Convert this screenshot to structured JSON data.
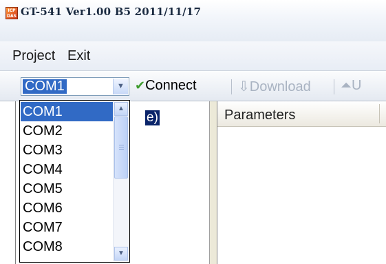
{
  "window": {
    "title": "GT-541 Ver1.00 B5 2011/11/17",
    "icon_text": "ICP DAS"
  },
  "menu": {
    "items": [
      "Project",
      "Exit"
    ]
  },
  "toolbar": {
    "port_value": "COM1",
    "connect_label": "Connect",
    "download_label": "Download",
    "upload_label": "U"
  },
  "tree": {
    "selected_fragment": "e)"
  },
  "grid": {
    "header": "Parameters"
  },
  "dropdown": {
    "options": [
      "COM1",
      "COM2",
      "COM3",
      "COM4",
      "COM5",
      "COM6",
      "COM7",
      "COM8"
    ],
    "selected": "COM1"
  },
  "colors": {
    "selection": "#316ac5",
    "tree_selection": "#0a246a",
    "check_icon": "#3f9c2f"
  },
  "icons": {
    "app": "icp-das-logo-icon",
    "connect": "checkmark-icon",
    "download": "download-arrow-icon",
    "upload": "upload-arrow-icon"
  }
}
